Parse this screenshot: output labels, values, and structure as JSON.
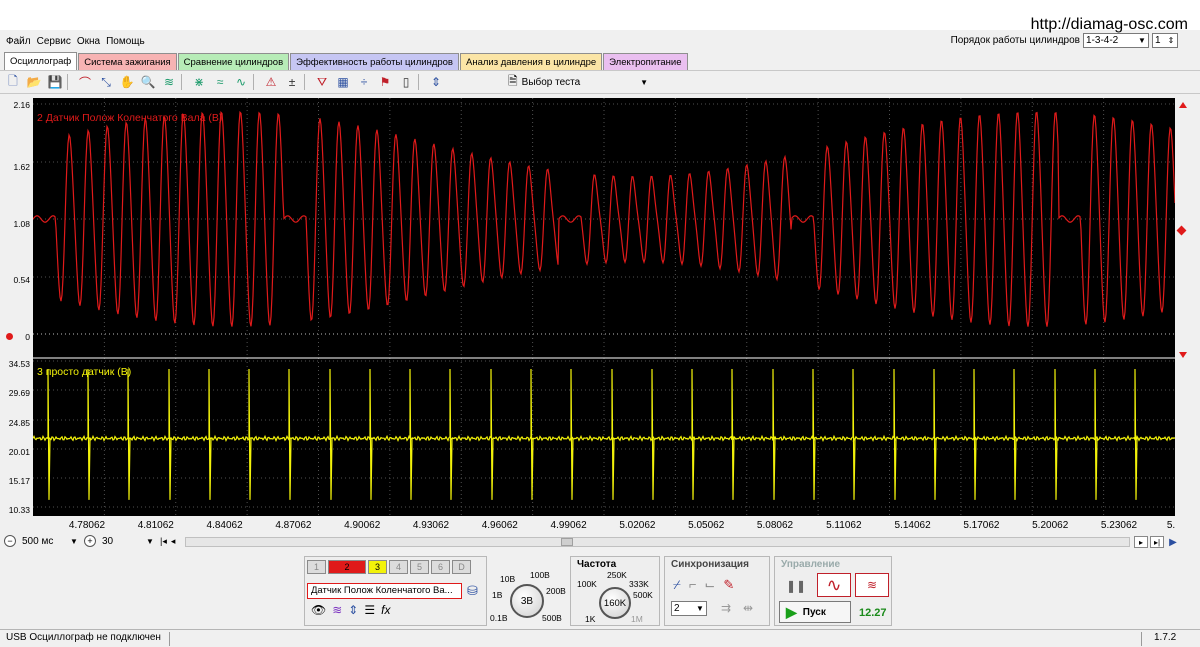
{
  "watermark": "http://diamag-osc.com",
  "menu": [
    "Файл",
    "Сервис",
    "Окна",
    "Помощь"
  ],
  "cylinder_order": {
    "label": "Порядок работы цилиндров",
    "value": "1-3-4-2",
    "count": "1"
  },
  "tabs": [
    {
      "label": "Осциллограф",
      "color": "#ffffff",
      "active": true
    },
    {
      "label": "Система зажигания",
      "color": "#f7b3b3",
      "active": false
    },
    {
      "label": "Сравнение цилиндров",
      "color": "#b7ecb7",
      "active": false
    },
    {
      "label": "Эффективность работы цилиндров",
      "color": "#c6c6f3",
      "active": false
    },
    {
      "label": "Анализ давления в цилиндре",
      "color": "#fbe5a6",
      "active": false
    },
    {
      "label": "Электропитание",
      "color": "#eabff0",
      "active": false
    }
  ],
  "toolbar": {
    "icons": [
      "new-file-icon",
      "open-folder-icon",
      "save-icon",
      "sep",
      "cursor-arc-icon",
      "cursor-move-icon",
      "hand-icon",
      "zoom-icon",
      "filter-icon",
      "sep",
      "pulse-up-icon",
      "pulse-wave-icon",
      "pulse-double-icon",
      "sep",
      "auto-icon",
      "zero-icon",
      "sep",
      "funnel-icon",
      "grid-icon",
      "split-icon",
      "flag-icon",
      "page-icon",
      "sep",
      "auto-scale-icon"
    ],
    "test_select": "Выбор теста"
  },
  "channels": {
    "ch2": {
      "title": "2 Датчик Полож Коленчатого Вала (В)",
      "color": "#e01a1a",
      "ticks": [
        "2.16",
        "1.62",
        "1.08",
        "0.54",
        "0"
      ]
    },
    "ch3": {
      "title": "3 просто датчик (В)",
      "color": "#f2f20a",
      "ticks": [
        "34.53",
        "29.69",
        "24.85",
        "20.01",
        "15.17",
        "10.33"
      ]
    }
  },
  "chart_data": {
    "type": "line",
    "title": "",
    "xlabel": "",
    "x_ticks": [
      "4.78062",
      "4.81062",
      "4.84062",
      "4.87062",
      "4.90062",
      "4.93062",
      "4.96062",
      "4.99062",
      "5.02062",
      "5.05062",
      "5.08062",
      "5.11062",
      "5.14062",
      "5.17062",
      "5.20062",
      "5.23062",
      "5."
    ],
    "xlim": [
      4.7636,
      5.2598
    ],
    "grid": true,
    "series": [
      {
        "name": "2 Датчик Полож Коленчатого Вала (В)",
        "units": "В",
        "ylim": [
          -0.1,
          2.16
        ],
        "waveform": "sinusoidal crankshaft signal with gap per revolution",
        "amplitude_range": [
          0.3,
          1.9
        ],
        "baseline": 1.08,
        "teeth_between_gaps": 12,
        "gap_times": [
          4.7636,
          4.8725,
          4.992,
          5.093,
          5.209
        ]
      },
      {
        "name": "3 просто датчик (В)",
        "units": "В",
        "ylim": [
          10.33,
          34.53
        ],
        "waveform": "flat baseline with periodic up/down spikes",
        "baseline": 21.7,
        "spike_high": 33.2,
        "spike_low": 11.5,
        "spike_times": [
          4.77,
          4.7875,
          4.805,
          4.8225,
          4.84,
          4.8575,
          4.875,
          4.8925,
          4.91,
          4.9275,
          4.945,
          4.9625,
          4.98,
          4.9975,
          5.015,
          5.0325,
          5.05,
          5.0675,
          5.085,
          5.1025,
          5.12,
          5.1375,
          5.155,
          5.1725,
          5.19,
          5.2075,
          5.225,
          5.2425
        ]
      }
    ]
  },
  "controls": {
    "timebase": "500 мс",
    "zoom": "30",
    "channels_label": "",
    "channel_buttons": [
      "1",
      "2",
      "3",
      "4",
      "5",
      "6",
      "D"
    ],
    "active_channel_colors": {
      "2": "#e01a1a",
      "3": "#f2f20a"
    },
    "sensor_name": "Датчик Полож Коленчатого Ва...",
    "voltage": {
      "value": "3В",
      "labels": [
        "10В",
        "100В",
        "1В",
        "200В",
        "0.1В",
        "500В"
      ]
    },
    "frequency": {
      "title": "Частота",
      "value": "160K",
      "labels": [
        "250K",
        "100K",
        "333K",
        "500K",
        "1K",
        "1M"
      ]
    },
    "sync": {
      "title": "Синхронизация",
      "channel": "2"
    },
    "control": {
      "title": "Управление",
      "start_label": "Пуск",
      "value": "12.27"
    }
  },
  "statusbar": {
    "left": "USB Осциллограф не подключен",
    "version": "1.7.2"
  }
}
